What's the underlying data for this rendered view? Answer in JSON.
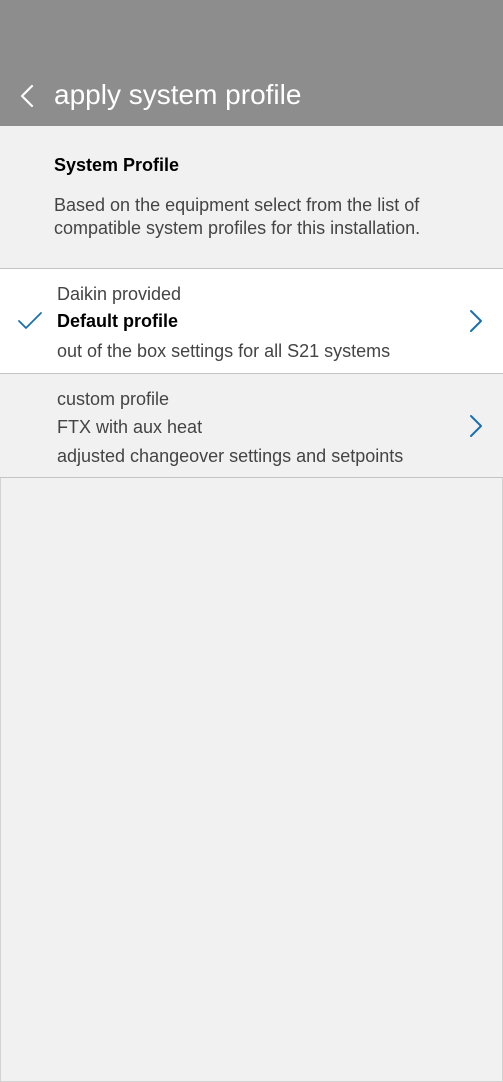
{
  "header": {
    "title": "apply system profile",
    "background_color": "#8d8d8d"
  },
  "intro": {
    "title": "System Profile",
    "description": "Based on the equipment select from the list of compatible system profiles for this installation."
  },
  "profiles": [
    {
      "source": "Daikin provided",
      "name": "Default profile",
      "description": "out of the box settings for all S21 systems",
      "selected": true
    },
    {
      "source": "custom profile",
      "name": "FTX with aux heat",
      "description": "adjusted changeover settings and setpoints",
      "selected": false
    }
  ],
  "icons": {
    "back": "chevron-left-icon",
    "selected": "checkmark-icon",
    "open": "chevron-right-icon"
  },
  "colors": {
    "accent": "#1a6fb0",
    "background": "#f1f1f1",
    "selected_row": "#ffffff"
  }
}
